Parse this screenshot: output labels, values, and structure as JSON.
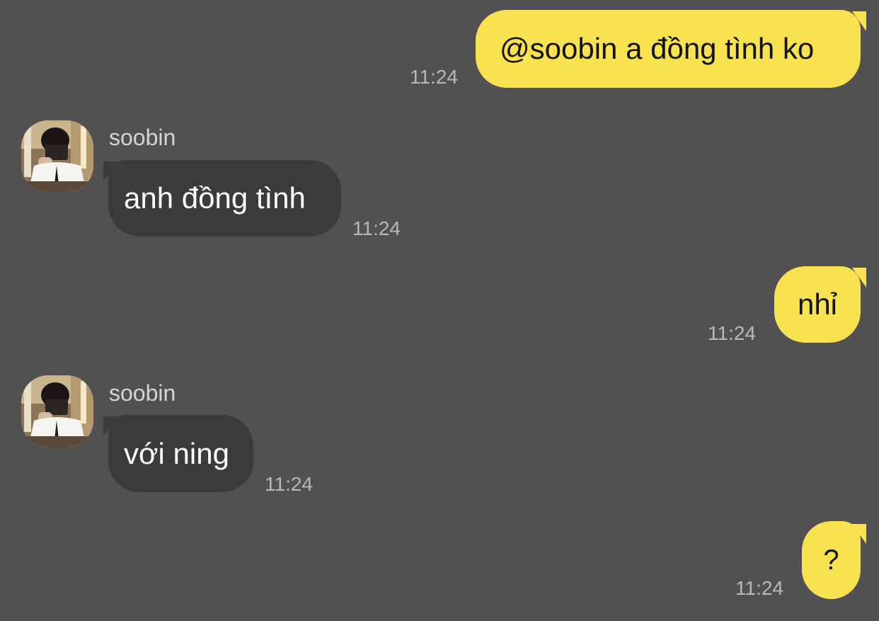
{
  "chat": {
    "messages": [
      {
        "direction": "outgoing",
        "text": "@soobin a đồng tình ko",
        "time": "11:24"
      },
      {
        "direction": "incoming",
        "sender": "soobin",
        "text": "anh đồng tình",
        "time": "11:24"
      },
      {
        "direction": "outgoing",
        "text": "nhỉ",
        "time": "11:24"
      },
      {
        "direction": "incoming",
        "sender": "soobin",
        "text": "với ning",
        "time": "11:24"
      },
      {
        "direction": "outgoing",
        "text": "?",
        "time": "11:24"
      }
    ]
  },
  "colors": {
    "background": "#525052",
    "outgoing_bubble": "#f8e24f",
    "incoming_bubble": "#3b3a3d",
    "timestamp": "#b9b8ba",
    "sender_name": "#d4d3d5"
  }
}
